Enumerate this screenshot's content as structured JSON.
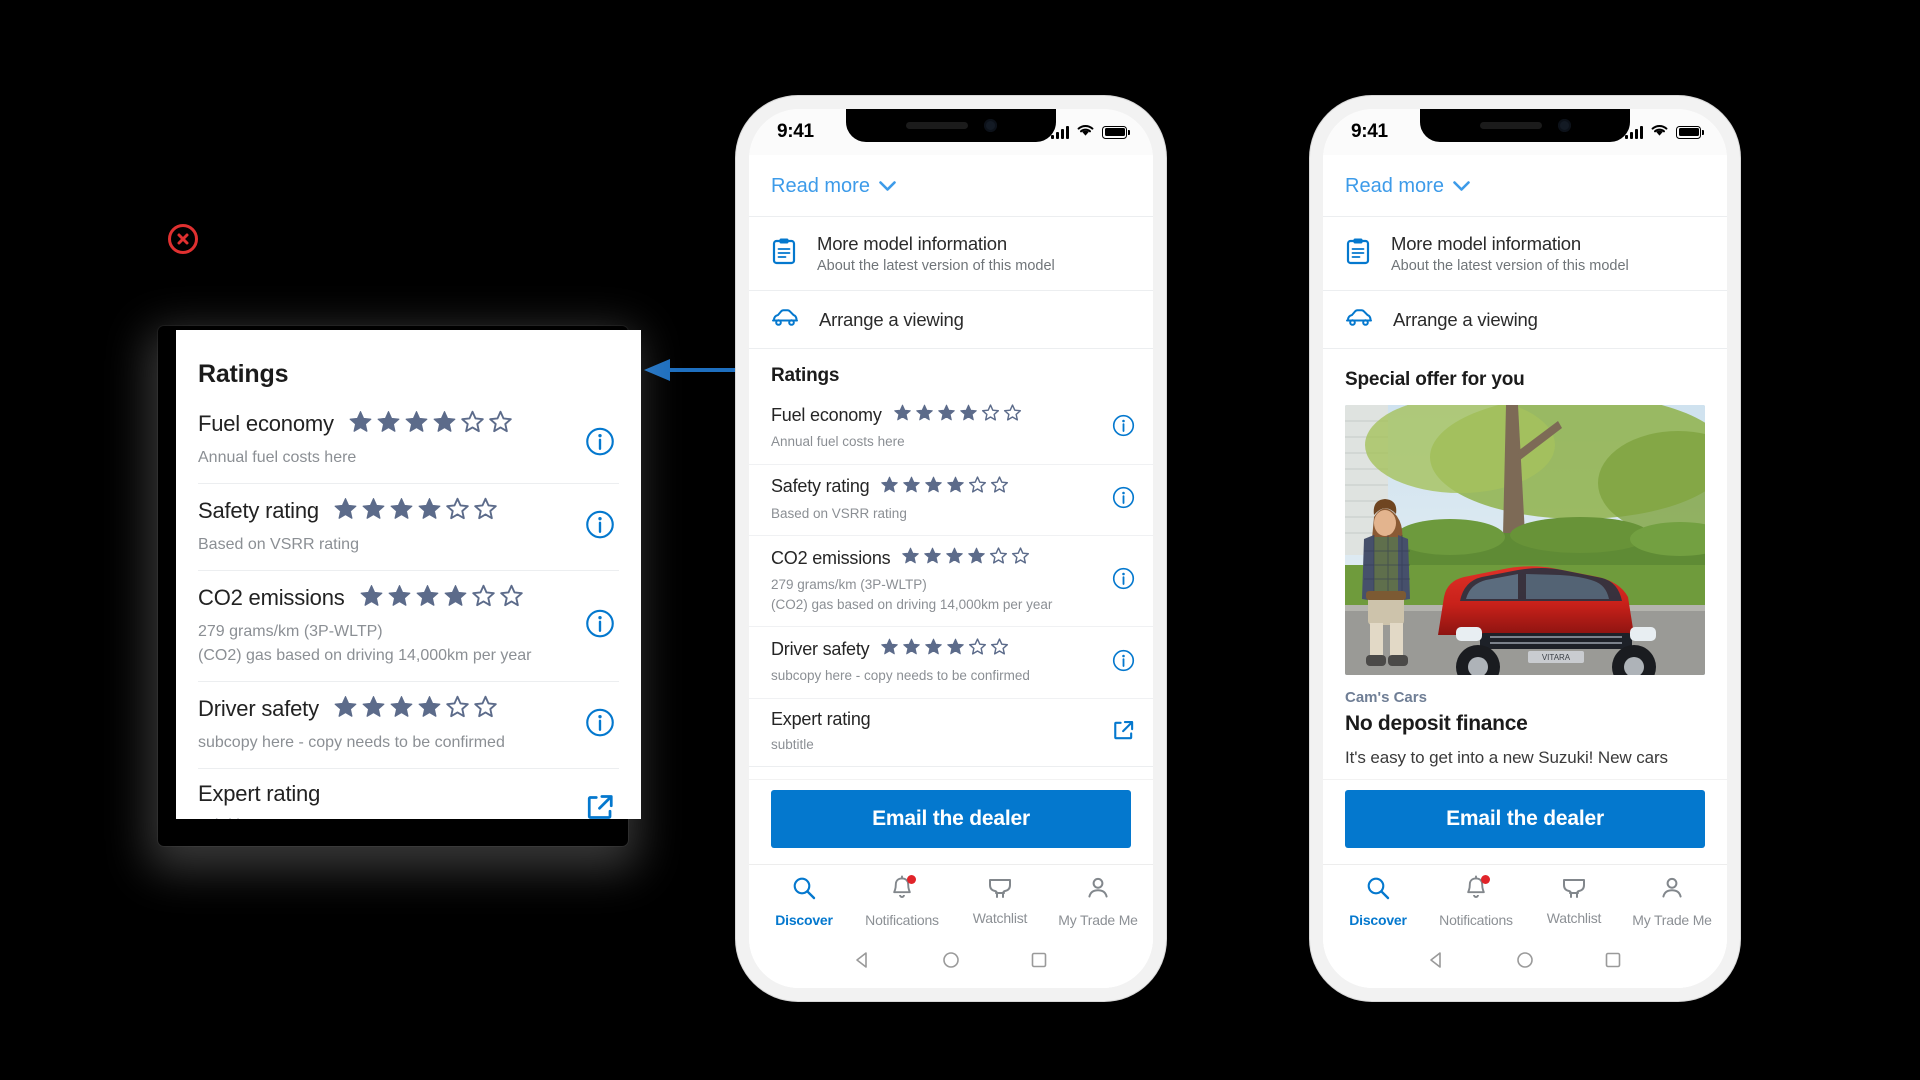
{
  "annotations": {
    "error_marker_icon": "circle-x-icon",
    "callout_arrow_icon": "left-arrow-icon"
  },
  "callout": {
    "title": "Ratings",
    "rows": [
      {
        "label": "Fuel economy",
        "subtitle": "Annual fuel costs here",
        "stars_filled": 4,
        "stars_total": 6,
        "icon": "info-icon"
      },
      {
        "label": "Safety rating",
        "subtitle": "Based on VSRR rating",
        "stars_filled": 4,
        "stars_total": 6,
        "icon": "info-icon"
      },
      {
        "label": "CO2 emissions",
        "subtitle": "279 grams/km (3P-WLTP)\n(CO2) gas based on driving 14,000km per year",
        "stars_filled": 4,
        "stars_total": 6,
        "icon": "info-icon"
      },
      {
        "label": "Driver safety",
        "subtitle": "subcopy here - copy needs to be confirmed",
        "stars_filled": 4,
        "stars_total": 6,
        "icon": "info-icon"
      },
      {
        "label": "Expert rating",
        "subtitle": "subtitle",
        "stars_filled": 0,
        "stars_total": 0,
        "icon": "external-link-icon"
      }
    ]
  },
  "phone_mid": {
    "status": {
      "time": "9:41",
      "signal_icon": "cellular-bars-icon",
      "wifi_icon": "wifi-icon",
      "battery_icon": "battery-full-icon"
    },
    "read_more": {
      "label": "Read more",
      "chevron_icon": "chevron-down-icon"
    },
    "links": [
      {
        "title": "More model information",
        "subtitle": "About the latest version of this model",
        "icon": "clipboard-icon"
      },
      {
        "title": "Arrange a viewing",
        "subtitle": "",
        "icon": "car-icon"
      }
    ],
    "ratings_title": "Ratings",
    "ratings": [
      {
        "label": "Fuel economy",
        "subtitle": "Annual fuel costs here",
        "stars_filled": 4,
        "stars_total": 6,
        "icon": "info-icon"
      },
      {
        "label": "Safety rating",
        "subtitle": "Based on VSRR rating",
        "stars_filled": 4,
        "stars_total": 6,
        "icon": "info-icon"
      },
      {
        "label": "CO2 emissions",
        "subtitle": "279 grams/km (3P-WLTP)\n(CO2) gas based on driving 14,000km per year",
        "stars_filled": 4,
        "stars_total": 6,
        "icon": "info-icon"
      },
      {
        "label": "Driver safety",
        "subtitle": "subcopy here - copy needs to be confirmed",
        "stars_filled": 4,
        "stars_total": 6,
        "icon": "info-icon"
      },
      {
        "label": "Expert rating",
        "subtitle": "subtitle",
        "stars_filled": 0,
        "stars_total": 0,
        "icon": "external-link-icon"
      }
    ],
    "special_offer_title": "Special offer for you",
    "cta_label": "Email the dealer",
    "tabs": [
      {
        "label": "Discover",
        "icon": "search-icon",
        "active": true,
        "badge": false
      },
      {
        "label": "Notifications",
        "icon": "bell-icon",
        "active": false,
        "badge": true
      },
      {
        "label": "Watchlist",
        "icon": "watchlist-icon",
        "active": false,
        "badge": false
      },
      {
        "label": "My Trade Me",
        "icon": "person-icon",
        "active": false,
        "badge": false
      }
    ],
    "sysnav": {
      "back_icon": "triangle-back-icon",
      "home_icon": "circle-home-icon",
      "recents_icon": "square-recents-icon"
    }
  },
  "phone_right": {
    "status": {
      "time": "9:41",
      "signal_icon": "cellular-bars-icon",
      "wifi_icon": "wifi-icon",
      "battery_icon": "battery-full-icon"
    },
    "read_more": {
      "label": "Read more",
      "chevron_icon": "chevron-down-icon"
    },
    "links": [
      {
        "title": "More model information",
        "subtitle": "About the latest version of this model",
        "icon": "clipboard-icon"
      },
      {
        "title": "Arrange a viewing",
        "subtitle": "",
        "icon": "car-icon"
      }
    ],
    "special_offer_title": "Special offer for you",
    "offer": {
      "image_alt": "person standing beside red Suzuki Vitara in a driveway",
      "dealer": "Cam's Cars",
      "headline": "No deposit finance",
      "body": "It's easy to get into a new Suzuki! New cars"
    },
    "cta_label": "Email the dealer",
    "tabs": [
      {
        "label": "Discover",
        "icon": "search-icon",
        "active": true,
        "badge": false
      },
      {
        "label": "Notifications",
        "icon": "bell-icon",
        "active": false,
        "badge": true
      },
      {
        "label": "Watchlist",
        "icon": "watchlist-icon",
        "active": false,
        "badge": false
      },
      {
        "label": "My Trade Me",
        "icon": "person-icon",
        "active": false,
        "badge": false
      }
    ],
    "sysnav": {
      "back_icon": "triangle-back-icon",
      "home_icon": "circle-home-icon",
      "recents_icon": "square-recents-icon"
    }
  },
  "colors": {
    "brand_blue": "#0478ce",
    "link_blue": "#3d9be9",
    "star": "#5c6b8a",
    "badge_red": "#e1242a",
    "marker_red": "#e03030"
  }
}
